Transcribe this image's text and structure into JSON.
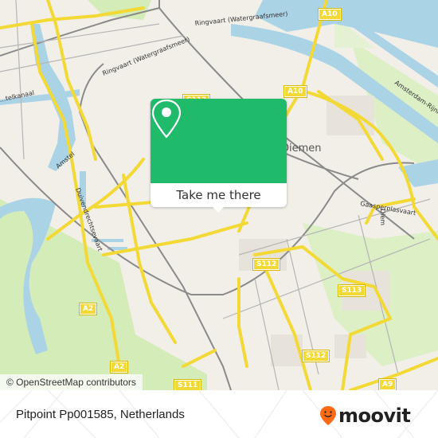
{
  "map": {
    "labels": {
      "ringvaart_1": "Ringvaart (Watergraafsmeer)",
      "ringvaart_2": "Ringvaart (Watergraafsmeer)",
      "amstel": "Amstel",
      "duivendrecht": "Duivendrechtsevaart",
      "amsterdam_rijnkanaal": "Amsterdam-Rijnkanaal",
      "diemen": "Diemen",
      "kanaal_left": "...telkanaal",
      "gaasp": "Gaasperplasvaart",
      "diem": "Diem"
    },
    "shields": [
      {
        "id": "a10-top",
        "label": "A10"
      },
      {
        "id": "a10-mid",
        "label": "A10"
      },
      {
        "id": "s112-top",
        "label": "S112"
      },
      {
        "id": "s112-mid",
        "label": "S112"
      },
      {
        "id": "s112-bottom",
        "label": "S112"
      },
      {
        "id": "s113",
        "label": "S113"
      },
      {
        "id": "a2-top",
        "label": "A2"
      },
      {
        "id": "a2-bottom",
        "label": "A2"
      },
      {
        "id": "s111",
        "label": "S111"
      },
      {
        "id": "a9",
        "label": "A9"
      }
    ],
    "attribution": "© OpenStreetMap contributors"
  },
  "popup": {
    "icon": "map-pin-icon",
    "button_label": "Take me there",
    "color": "#1fba6a"
  },
  "footer": {
    "place_name": "Pitpoint Pp001585, Netherlands",
    "brand": "moovit",
    "brand_color": "#ff6a13"
  }
}
